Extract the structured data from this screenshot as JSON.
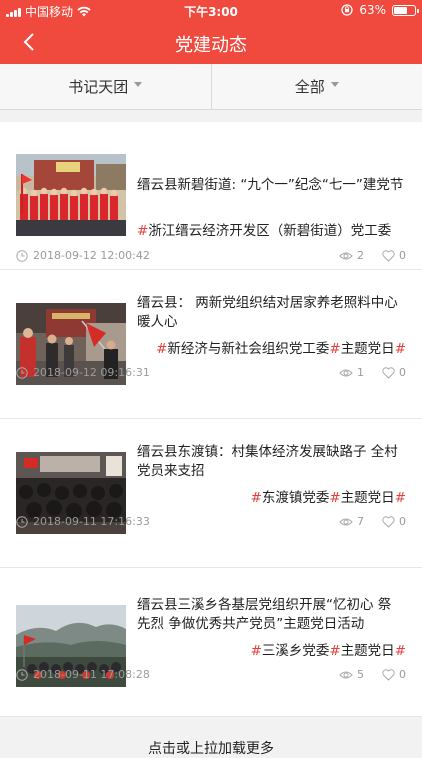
{
  "status_bar": {
    "carrier": "中国移动",
    "time": "下午3:00",
    "battery": "63%",
    "battery_level": 0.63
  },
  "nav": {
    "title": "党建动态",
    "back_icon": "chevron-left-icon"
  },
  "filters": [
    {
      "label": "书记天团"
    },
    {
      "label": "全部"
    }
  ],
  "articles": [
    {
      "title": "缙云县新碧街道: “九个一”纪念“七一”建党节",
      "tags": "浙江缙云经济开发区（新碧街道）党工委",
      "tags_align": "left",
      "date": "2018-09-12 12:00:42",
      "views": "2",
      "likes": "0"
    },
    {
      "title": "缙云县： 两新党组织结对居家养老照料中心暖人心",
      "tags": "新经济与新社会组织党工委#主题党日",
      "tags_align": "right",
      "date": "2018-09-12 09:16:31",
      "views": "1",
      "likes": "0"
    },
    {
      "title": "缙云县东渡镇：村集体经济发展缺路子 全村党员来支招",
      "tags": "东渡镇党委#主题党日",
      "tags_align": "right",
      "date": "2018-09-11 17:16:33",
      "views": "7",
      "likes": "0"
    },
    {
      "title": "缙云县三溪乡各基层党组织开展“忆初心 祭先烈 争做优秀共产党员”主题党日活动",
      "tags": "三溪乡党委#主题党日",
      "tags_align": "right",
      "date": "2018-09-11 17:08:28",
      "views": "5",
      "likes": "0"
    }
  ],
  "load_more": "点击或上拉加载更多",
  "colors": {
    "brand_red": "#ef4a3d",
    "hashtag_red": "#e5413a"
  }
}
